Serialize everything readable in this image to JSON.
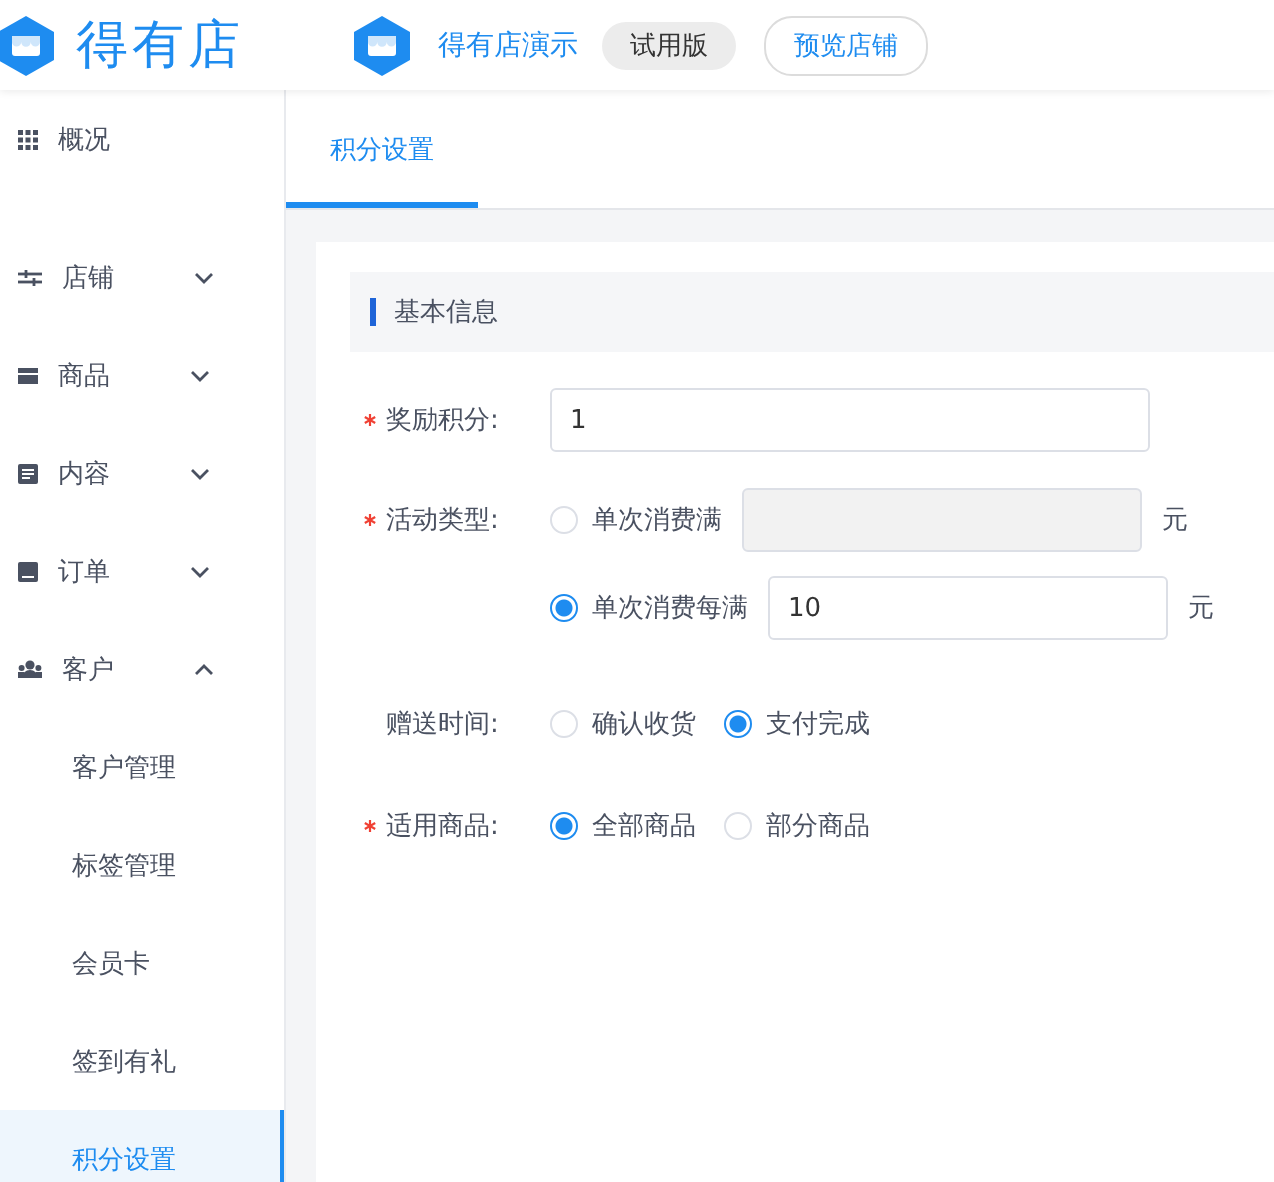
{
  "header": {
    "logo_text": "得有店",
    "store_name": "得有店演示",
    "badge": "试用版",
    "preview_button": "预览店铺"
  },
  "sidebar": {
    "items": [
      {
        "label": "概况",
        "kind": "link"
      },
      {
        "label": "店铺",
        "kind": "group",
        "expanded": false
      },
      {
        "label": "商品",
        "kind": "group",
        "expanded": false
      },
      {
        "label": "内容",
        "kind": "group",
        "expanded": false
      },
      {
        "label": "订单",
        "kind": "group",
        "expanded": false
      },
      {
        "label": "客户",
        "kind": "group",
        "expanded": true,
        "children": [
          {
            "label": "客户管理",
            "selected": false
          },
          {
            "label": "标签管理",
            "selected": false
          },
          {
            "label": "会员卡",
            "selected": false
          },
          {
            "label": "签到有礼",
            "selected": false
          },
          {
            "label": "积分设置",
            "selected": true
          }
        ]
      }
    ]
  },
  "tabs": [
    {
      "label": "积分设置",
      "selected": true
    }
  ],
  "form": {
    "section_title": "基本信息",
    "fields": [
      {
        "label": "奖励积分:",
        "required": true,
        "kind": "input",
        "value": "1"
      },
      {
        "label": "活动类型:",
        "required": true,
        "kind": "amount_options",
        "options": [
          {
            "label": "单次消费满",
            "selected": false,
            "unit": "元"
          },
          {
            "label": "单次消费每满",
            "selected": true,
            "value": "10",
            "unit": "元"
          }
        ]
      },
      {
        "label": "赠送时间:",
        "required": false,
        "kind": "radio",
        "options": [
          {
            "label": "确认收货",
            "selected": false
          },
          {
            "label": "支付完成",
            "selected": true
          }
        ]
      },
      {
        "label": "适用商品:",
        "required": true,
        "kind": "radio",
        "options": [
          {
            "label": "全部商品",
            "selected": true
          },
          {
            "label": "部分商品",
            "selected": false
          }
        ]
      }
    ]
  }
}
